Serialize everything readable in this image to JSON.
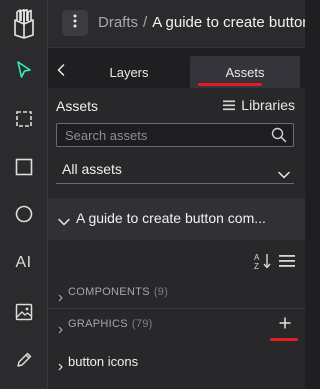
{
  "header": {
    "breadcrumb_parent": "Drafts",
    "breadcrumb_separator": "/",
    "breadcrumb_current": "A guide to create button comp",
    "menu_icon": "vertical-dots-icon"
  },
  "toolbar": {
    "logo_icon": "penpot-logo-icon",
    "tools": [
      {
        "name": "move",
        "icon": "pointer-icon"
      },
      {
        "name": "board",
        "icon": "board-icon"
      },
      {
        "name": "rectangle",
        "icon": "rectangle-icon"
      },
      {
        "name": "ellipse",
        "icon": "ellipse-icon"
      },
      {
        "name": "text",
        "icon": "text-icon",
        "label": "AI"
      },
      {
        "name": "image",
        "icon": "image-icon"
      },
      {
        "name": "pen",
        "icon": "pen-icon"
      }
    ],
    "active_tool": "move"
  },
  "tabs": {
    "layers_label": "Layers",
    "assets_label": "Assets",
    "active": "Assets"
  },
  "assets": {
    "title": "Assets",
    "libraries_label": "Libraries",
    "search_placeholder": "Search assets",
    "filter_value": "All assets",
    "file_name": "A guide to create button com...",
    "sections": {
      "components_label": "COMPONENTS",
      "components_count": "(9)",
      "graphics_label": "GRAPHICS",
      "graphics_count": "(79)"
    },
    "group_label": "button icons"
  },
  "colors": {
    "accent_green": "#31efb8",
    "annotation_red": "#e21d1d",
    "panel_bg": "#28282b",
    "toolbar_bg": "#2b2b2d"
  }
}
